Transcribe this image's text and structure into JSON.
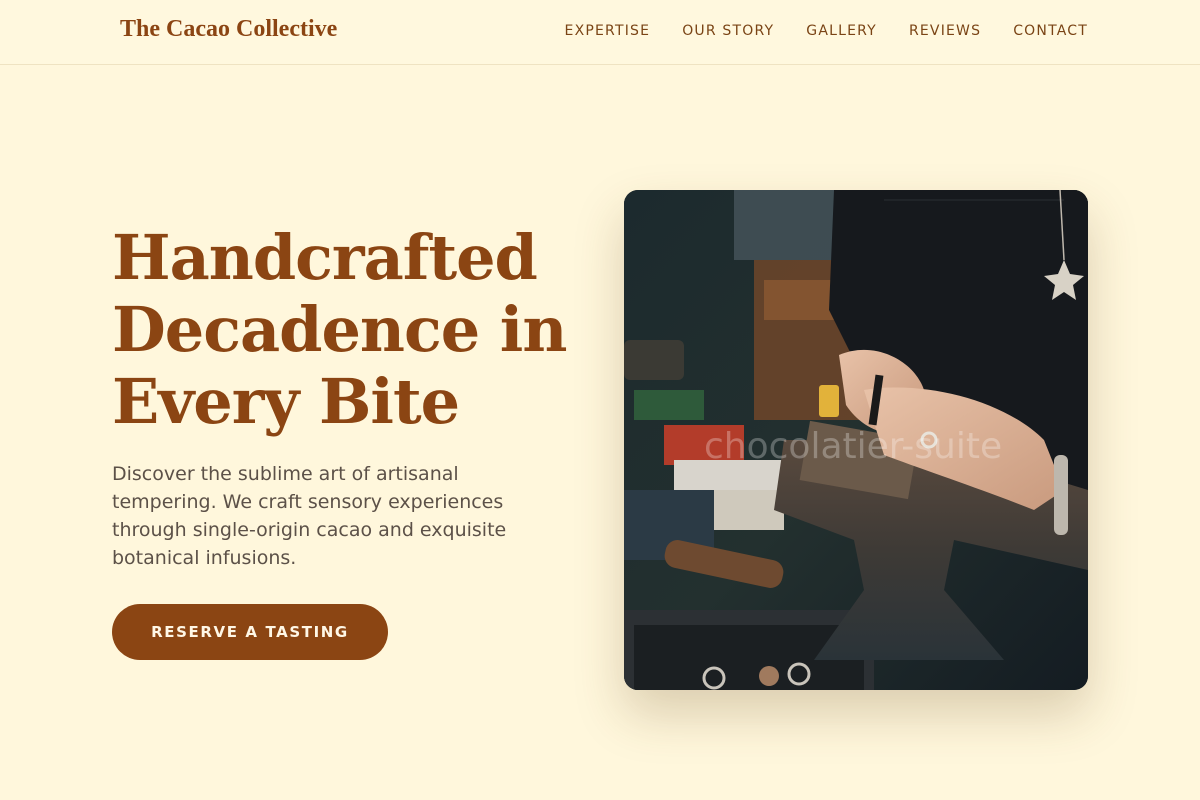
{
  "header": {
    "brand": "The Cacao Collective",
    "nav": [
      {
        "label": "EXPERTISE"
      },
      {
        "label": "OUR STORY"
      },
      {
        "label": "GALLERY"
      },
      {
        "label": "REVIEWS"
      },
      {
        "label": "CONTACT"
      }
    ]
  },
  "hero": {
    "title": "Handcrafted Decadence in Every Bite",
    "subtitle": "Discover the sublime art of artisanal tempering. We craft sensory experiences through single-origin cacao and exquisite botanical infusions.",
    "cta_label": "RESERVE A TASTING",
    "image": {
      "subject": "artisan-hands-working-on-anvil",
      "watermark": "chocolatier-suite"
    }
  },
  "colors": {
    "background": "#fff7dc",
    "brand": "#8b4513",
    "body_text": "#5c5148",
    "button_text": "#fff7e6"
  }
}
